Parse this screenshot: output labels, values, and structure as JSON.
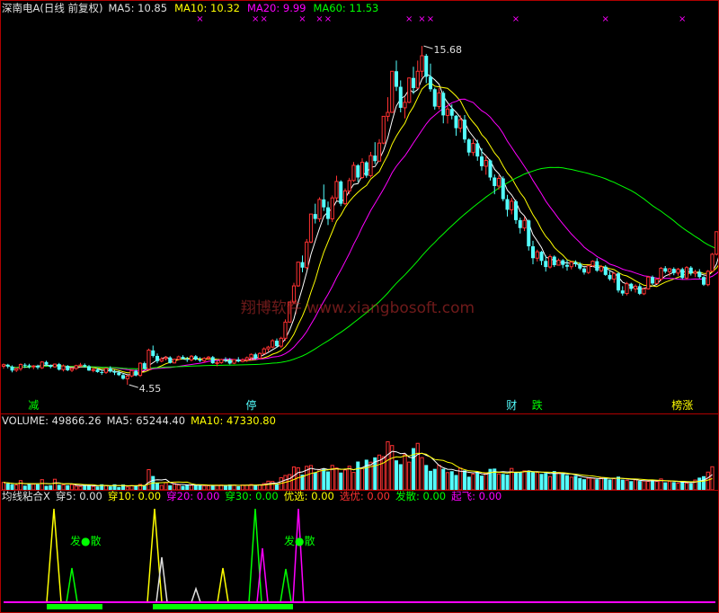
{
  "colors": {
    "bg": "#000000",
    "up": "#ff3232",
    "down": "#54ffff",
    "border": "#b00000",
    "ma5": "#ffffff",
    "ma10": "#ffff00",
    "ma20": "#ff00ff",
    "ma60": "#00ff00",
    "white": "#e0e0e0",
    "green": "#00ff00",
    "pink": "#ff00ff",
    "red": "#ff3232",
    "watermark": "#c83030"
  },
  "header": {
    "stock": "深南电A(日线 前复权)",
    "ma5_label": "MA5: 10.85",
    "ma10_label": "MA10: 10.32",
    "ma20_label": "MA20: 9.99",
    "ma60_label": "MA60: 11.53"
  },
  "annotations": {
    "high_label": "15.68",
    "low_label": "4.55",
    "markers": [
      {
        "text": "减",
        "color": "#00ff00",
        "index": 7
      },
      {
        "text": "停",
        "color": "#54ffff",
        "index": 58
      },
      {
        "text": "财",
        "color": "#54ffff",
        "index": 119
      },
      {
        "text": "跌",
        "color": "#00ff00",
        "index": 125
      },
      {
        "text": "榜涨",
        "color": "#ffff00",
        "index": 159
      }
    ],
    "top_marks": [
      46,
      59,
      61,
      70,
      74,
      76,
      95,
      98,
      100,
      120,
      141,
      159
    ],
    "watermark": "翔博软件 www.xiangbosoft.com"
  },
  "volume": {
    "label": "VOLUME: 49866.26",
    "ma5_label": "MA5: 65244.40",
    "ma10_label": "MA10: 47330.80"
  },
  "indicator": {
    "items": [
      {
        "text": "均线粘合X",
        "color": "#e0e0e0"
      },
      {
        "text": "穿5: 0.00",
        "color": "#e0e0e0"
      },
      {
        "text": "穿10: 0.00",
        "color": "#ffff00"
      },
      {
        "text": "穿20: 0.00",
        "color": "#ff00ff"
      },
      {
        "text": "穿30: 0.00",
        "color": "#00ff00"
      },
      {
        "text": "优选: 0.00",
        "color": "#ffff00"
      },
      {
        "text": "选优: 0.00",
        "color": "#ff3232"
      },
      {
        "text": "发散: 0.00",
        "color": "#00ff00"
      },
      {
        "text": "起飞: 0.00",
        "color": "#ff00ff"
      }
    ],
    "fa_san": "发●散"
  },
  "chart_data": {
    "type": "candlestick",
    "price_range": [
      4.2,
      16.6
    ],
    "volume_range": [
      0,
      130000
    ],
    "candles": [
      [
        5.16,
        5.25,
        5.08,
        5.21
      ],
      [
        5.21,
        5.24,
        5.09,
        5.15
      ],
      [
        5.15,
        5.19,
        4.96,
        5.02
      ],
      [
        5.03,
        5.12,
        4.97,
        5.08
      ],
      [
        5.08,
        5.25,
        5.01,
        5.22
      ],
      [
        5.21,
        5.26,
        5.1,
        5.18
      ],
      [
        5.19,
        5.24,
        5.09,
        5.15
      ],
      [
        5.15,
        5.2,
        5.06,
        5.17
      ],
      [
        5.17,
        5.21,
        5.06,
        5.12
      ],
      [
        5.11,
        5.33,
        5.07,
        5.3
      ],
      [
        5.3,
        5.34,
        5.17,
        5.21
      ],
      [
        5.2,
        5.22,
        5.09,
        5.14
      ],
      [
        5.14,
        5.25,
        5.11,
        5.23
      ],
      [
        5.23,
        5.27,
        5.02,
        5.05
      ],
      [
        5.05,
        5.22,
        4.99,
        5.17
      ],
      [
        5.17,
        5.2,
        5.0,
        5.03
      ],
      [
        5.03,
        5.12,
        4.97,
        5.09
      ],
      [
        5.09,
        5.21,
        5.04,
        5.18
      ],
      [
        5.18,
        5.27,
        5.14,
        5.2
      ],
      [
        5.2,
        5.25,
        5.12,
        5.16
      ],
      [
        5.16,
        5.2,
        5.01,
        5.02
      ],
      [
        5.02,
        5.1,
        4.96,
        5.05
      ],
      [
        5.05,
        5.1,
        4.95,
        4.97
      ],
      [
        4.97,
        5.04,
        4.88,
        4.95
      ],
      [
        4.96,
        5.11,
        4.91,
        5.09
      ],
      [
        5.09,
        5.16,
        4.95,
        4.99
      ],
      [
        4.99,
        5.04,
        4.87,
        4.95
      ],
      [
        4.95,
        5.02,
        4.84,
        4.87
      ],
      [
        4.87,
        4.93,
        4.72,
        4.75
      ],
      [
        4.75,
        4.88,
        4.55,
        4.84
      ],
      [
        4.84,
        5.04,
        4.8,
        5.02
      ],
      [
        5.01,
        5.05,
        4.83,
        4.86
      ],
      [
        4.86,
        5.29,
        4.81,
        5.26
      ],
      [
        5.26,
        5.31,
        5.05,
        5.08
      ],
      [
        5.07,
        5.74,
        5.04,
        5.69
      ],
      [
        5.68,
        5.84,
        5.45,
        5.5
      ],
      [
        5.5,
        5.58,
        5.26,
        5.33
      ],
      [
        5.33,
        5.46,
        5.29,
        5.4
      ],
      [
        5.41,
        5.5,
        5.35,
        5.45
      ],
      [
        5.45,
        5.49,
        5.25,
        5.27
      ],
      [
        5.27,
        5.41,
        5.25,
        5.39
      ],
      [
        5.39,
        5.51,
        5.35,
        5.47
      ],
      [
        5.47,
        5.52,
        5.38,
        5.4
      ],
      [
        5.4,
        5.47,
        5.3,
        5.38
      ],
      [
        5.37,
        5.53,
        5.32,
        5.49
      ],
      [
        5.49,
        5.53,
        5.35,
        5.38
      ],
      [
        5.38,
        5.46,
        5.3,
        5.34
      ],
      [
        5.34,
        5.46,
        5.28,
        5.42
      ],
      [
        5.42,
        5.5,
        5.37,
        5.46
      ],
      [
        5.46,
        5.5,
        5.24,
        5.26
      ],
      [
        5.26,
        5.34,
        5.16,
        5.28
      ],
      [
        5.28,
        5.41,
        5.24,
        5.38
      ],
      [
        5.38,
        5.46,
        5.29,
        5.36
      ],
      [
        5.36,
        5.43,
        5.22,
        5.25
      ],
      [
        5.26,
        5.4,
        5.23,
        5.38
      ],
      [
        5.38,
        5.46,
        5.29,
        5.32
      ],
      [
        5.32,
        5.42,
        5.29,
        5.37
      ],
      [
        5.37,
        5.48,
        5.3,
        5.44
      ],
      [
        5.44,
        5.58,
        5.36,
        5.55
      ],
      [
        5.55,
        5.6,
        5.38,
        5.42
      ],
      [
        5.42,
        5.62,
        5.39,
        5.58
      ],
      [
        5.58,
        5.78,
        5.55,
        5.73
      ],
      [
        5.73,
        5.83,
        5.64,
        5.79
      ],
      [
        5.79,
        6.05,
        5.75,
        6.0
      ],
      [
        6.0,
        6.07,
        5.77,
        5.82
      ],
      [
        5.82,
        6.13,
        5.76,
        6.08
      ],
      [
        6.08,
        6.7,
        6.0,
        6.61
      ],
      [
        6.61,
        7.27,
        6.6,
        7.27
      ],
      [
        7.27,
        7.9,
        7.2,
        7.8
      ],
      [
        7.8,
        8.58,
        7.77,
        8.58
      ],
      [
        8.58,
        8.8,
        8.25,
        8.4
      ],
      [
        8.4,
        9.34,
        8.35,
        9.24
      ],
      [
        9.24,
        10.16,
        9.2,
        10.16
      ],
      [
        10.16,
        10.5,
        9.85,
        10.0
      ],
      [
        10.0,
        10.71,
        9.9,
        10.64
      ],
      [
        10.64,
        11.13,
        10.26,
        10.38
      ],
      [
        10.38,
        10.57,
        9.8,
        10.0
      ],
      [
        10.0,
        10.77,
        9.9,
        10.69
      ],
      [
        10.69,
        11.42,
        10.6,
        11.23
      ],
      [
        11.23,
        11.27,
        10.42,
        10.5
      ],
      [
        10.5,
        11.0,
        10.45,
        10.92
      ],
      [
        10.92,
        11.35,
        10.81,
        11.26
      ],
      [
        11.26,
        11.87,
        11.22,
        11.76
      ],
      [
        11.76,
        11.8,
        11.21,
        11.36
      ],
      [
        11.36,
        11.99,
        11.31,
        11.86
      ],
      [
        11.86,
        11.9,
        11.35,
        11.42
      ],
      [
        11.42,
        12.2,
        11.36,
        12.08
      ],
      [
        12.08,
        12.52,
        11.8,
        11.9
      ],
      [
        11.9,
        12.62,
        11.88,
        12.49
      ],
      [
        12.49,
        13.37,
        12.45,
        13.37
      ],
      [
        13.37,
        14.0,
        13.2,
        13.5
      ],
      [
        13.5,
        14.85,
        13.48,
        14.85
      ],
      [
        14.85,
        15.2,
        14.2,
        14.34
      ],
      [
        14.34,
        14.55,
        13.5,
        13.65
      ],
      [
        13.65,
        14.0,
        13.3,
        13.83
      ],
      [
        13.83,
        14.63,
        13.8,
        14.63
      ],
      [
        14.63,
        15.0,
        14.1,
        14.3
      ],
      [
        14.3,
        15.2,
        14.3,
        14.85
      ],
      [
        14.85,
        15.68,
        14.64,
        15.36
      ],
      [
        15.36,
        15.42,
        14.46,
        14.67
      ],
      [
        14.67,
        15.1,
        14.18,
        14.26
      ],
      [
        14.26,
        14.31,
        13.59,
        13.69
      ],
      [
        13.69,
        14.3,
        13.6,
        14.14
      ],
      [
        14.14,
        14.2,
        13.14,
        13.4
      ],
      [
        13.4,
        13.75,
        13.13,
        13.61
      ],
      [
        13.61,
        13.76,
        13.27,
        13.39
      ],
      [
        13.39,
        13.41,
        12.73,
        12.98
      ],
      [
        12.98,
        13.4,
        12.84,
        13.26
      ],
      [
        13.26,
        13.41,
        12.5,
        12.61
      ],
      [
        12.61,
        12.65,
        12.07,
        12.18
      ],
      [
        12.18,
        12.62,
        12.07,
        12.48
      ],
      [
        12.48,
        12.6,
        11.91,
        12.05
      ],
      [
        12.05,
        12.32,
        11.59,
        11.73
      ],
      [
        11.73,
        12.08,
        11.45,
        11.92
      ],
      [
        11.92,
        11.95,
        11.26,
        11.36
      ],
      [
        11.36,
        11.46,
        10.81,
        11.08
      ],
      [
        11.08,
        11.43,
        10.96,
        11.33
      ],
      [
        11.33,
        11.4,
        10.58,
        10.65
      ],
      [
        10.65,
        10.79,
        10.08,
        10.3
      ],
      [
        10.3,
        10.69,
        10.15,
        10.58
      ],
      [
        10.58,
        10.63,
        9.84,
        9.96
      ],
      [
        9.96,
        10.04,
        9.52,
        9.7
      ],
      [
        9.7,
        10.06,
        9.6,
        9.95
      ],
      [
        9.95,
        9.98,
        8.96,
        9.1
      ],
      [
        9.1,
        9.28,
        8.51,
        8.71
      ],
      [
        8.71,
        8.99,
        8.6,
        8.92
      ],
      [
        8.92,
        8.95,
        8.48,
        8.62
      ],
      [
        8.62,
        8.8,
        8.27,
        8.42
      ],
      [
        8.42,
        8.83,
        8.37,
        8.76
      ],
      [
        8.76,
        8.8,
        8.42,
        8.48
      ],
      [
        8.48,
        8.7,
        8.47,
        8.64
      ],
      [
        8.64,
        8.68,
        8.38,
        8.49
      ],
      [
        8.49,
        8.65,
        8.3,
        8.43
      ],
      [
        8.43,
        8.62,
        8.34,
        8.58
      ],
      [
        8.58,
        8.64,
        8.43,
        8.52
      ],
      [
        8.52,
        8.58,
        8.32,
        8.37
      ],
      [
        8.37,
        8.41,
        8.17,
        8.24
      ],
      [
        8.24,
        8.49,
        8.19,
        8.46
      ],
      [
        8.46,
        8.64,
        8.42,
        8.61
      ],
      [
        8.61,
        8.71,
        8.26,
        8.3
      ],
      [
        8.3,
        8.49,
        8.25,
        8.43
      ],
      [
        8.43,
        8.48,
        8.13,
        8.16
      ],
      [
        8.16,
        8.28,
        7.97,
        8.02
      ],
      [
        8.02,
        8.25,
        7.9,
        8.21
      ],
      [
        8.21,
        8.26,
        7.58,
        7.65
      ],
      [
        7.65,
        7.79,
        7.48,
        7.55
      ],
      [
        7.55,
        7.93,
        7.49,
        7.87
      ],
      [
        7.87,
        7.9,
        7.62,
        7.7
      ],
      [
        7.7,
        7.85,
        7.58,
        7.79
      ],
      [
        7.79,
        7.87,
        7.5,
        7.54
      ],
      [
        7.54,
        7.73,
        7.5,
        7.7
      ],
      [
        7.7,
        8.13,
        7.68,
        8.09
      ],
      [
        8.09,
        8.14,
        7.83,
        7.88
      ],
      [
        7.88,
        8.07,
        7.86,
        8.02
      ],
      [
        8.02,
        8.42,
        7.96,
        8.38
      ],
      [
        8.38,
        8.45,
        8.21,
        8.27
      ],
      [
        8.27,
        8.39,
        8.11,
        8.36
      ],
      [
        8.36,
        8.41,
        8.15,
        8.22
      ],
      [
        8.22,
        8.39,
        8.13,
        8.35
      ],
      [
        8.35,
        8.4,
        8.02,
        8.06
      ],
      [
        8.06,
        8.45,
        8.0,
        8.4
      ],
      [
        8.4,
        8.45,
        8.14,
        8.21
      ],
      [
        8.21,
        8.33,
        8.09,
        8.26
      ],
      [
        8.26,
        8.35,
        8.04,
        8.09
      ],
      [
        8.09,
        8.12,
        7.8,
        7.84
      ],
      [
        7.84,
        8.32,
        7.79,
        8.28
      ],
      [
        8.28,
        8.88,
        8.26,
        8.84
      ],
      [
        8.84,
        9.58,
        8.8,
        9.58
      ],
      [
        9.58,
        10.48,
        9.5,
        10.38
      ],
      [
        10.38,
        11.1,
        10.0,
        10.85
      ]
    ],
    "volume": [
      16100,
      13800,
      12000,
      10500,
      19900,
      9100,
      13600,
      12100,
      12000,
      22000,
      8700,
      9900,
      22900,
      10800,
      10900,
      10200,
      11400,
      8000,
      7500,
      12000,
      9600,
      7400,
      7300,
      12000,
      9300,
      7400,
      12000,
      6000,
      11500,
      6200,
      9200,
      9400,
      11700,
      8900,
      43700,
      29900,
      15100,
      9600,
      15400,
      9700,
      13700,
      10600,
      8600,
      11000,
      9700,
      11300,
      10500,
      8400,
      8700,
      9800,
      10200,
      10500,
      8700,
      11600,
      10500,
      8000,
      10500,
      10000,
      11500,
      10200,
      11000,
      13600,
      18800,
      18200,
      12400,
      26200,
      31100,
      33000,
      49400,
      47700,
      32800,
      50800,
      52500,
      38000,
      44000,
      45700,
      39700,
      52800,
      47200,
      37400,
      43000,
      51100,
      37700,
      61100,
      46500,
      65100,
      59800,
      70100,
      75100,
      71700,
      104000,
      95700,
      63700,
      55400,
      76100,
      59900,
      90100,
      100400,
      69600,
      53600,
      41100,
      45300,
      53100,
      45400,
      37200,
      40200,
      32100,
      46900,
      42000,
      28400,
      34100,
      38600,
      30800,
      35900,
      45300,
      45900,
      34500,
      34300,
      32700,
      46200,
      38700,
      38500,
      41000,
      40700,
      38300,
      38100,
      34400,
      36400,
      28800,
      40500,
      37300,
      34700,
      31800,
      27300,
      30300,
      25700,
      23000,
      25200,
      25100,
      22900,
      25900,
      26800,
      22400,
      24400,
      28600,
      22100,
      20800,
      18800,
      21600,
      19200,
      19300,
      18400,
      21600,
      18200,
      23600,
      16200,
      18000,
      16700,
      14400,
      18100,
      14600,
      14000,
      21200,
      26400,
      29500,
      38300,
      49900
    ]
  }
}
